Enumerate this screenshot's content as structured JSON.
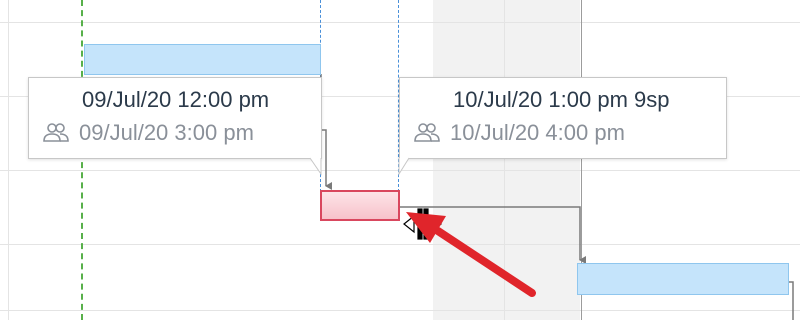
{
  "tooltips": [
    {
      "start": "09/Jul/20 12:00 pm",
      "end": "09/Jul/20 3:00 pm"
    },
    {
      "start": "10/Jul/20 1:00 pm 9sp",
      "end": "10/Jul/20 4:00 pm"
    }
  ],
  "icons": {
    "resources": "people-icon",
    "cursor": "resize-cursor-icon",
    "annotation": "red-arrow-annotation"
  },
  "colors": {
    "task_bar": "#c5e4fb",
    "dragged_task": "#f7c2ca",
    "dragged_task_border": "#d9475e",
    "today_line": "#58b04a",
    "guide_line": "#4a90d9",
    "dependency": "#7a7a7a",
    "annotation": "#e0252b"
  }
}
